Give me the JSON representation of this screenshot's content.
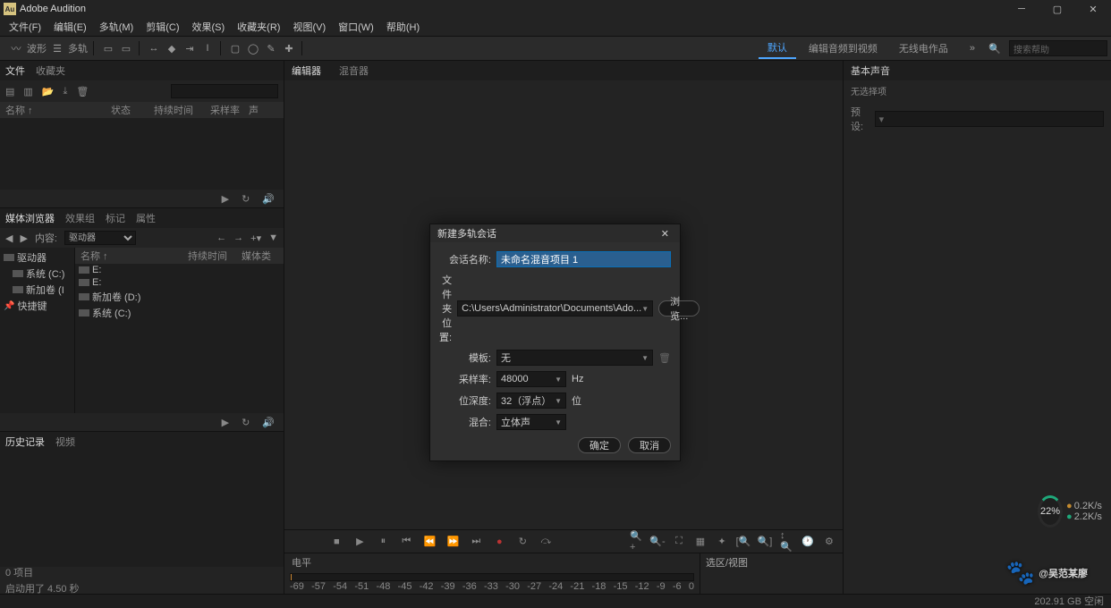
{
  "app": {
    "title": "Adobe Audition"
  },
  "menu": [
    "文件(F)",
    "编辑(E)",
    "多轨(M)",
    "剪辑(C)",
    "效果(S)",
    "收藏夹(R)",
    "视图(V)",
    "窗口(W)",
    "帮助(H)"
  ],
  "toolbar": {
    "waveform": "波形",
    "multitrack": "多轨"
  },
  "workspaces": {
    "default": "默认",
    "edit": "编辑音频到视频",
    "radio": "无线电作品"
  },
  "search_placeholder": "搜索帮助",
  "files_panel": {
    "tab_files": "文件",
    "tab_favorites": "收藏夹",
    "cols": [
      "名称 ↑",
      "状态",
      "持续时间",
      "采样率",
      "声"
    ]
  },
  "media_panel": {
    "tabs": [
      "媒体浏览器",
      "效果组",
      "标记",
      "属性"
    ],
    "content_label": "内容:",
    "content_value": "驱动器",
    "tree": [
      "驱动器",
      "系统 (C:)",
      "新加卷 (I",
      "快捷键"
    ],
    "right_tree": [
      "E:",
      "E:",
      "新加卷 (D:)",
      "系统 (C:)"
    ],
    "cols": [
      "名称 ↑",
      "持续时间",
      "媒体类"
    ]
  },
  "history_panel": {
    "tabs": [
      "历史记录",
      "视频"
    ],
    "line1": "0 项目",
    "line2": "启动用了 4.50 秒"
  },
  "editor": {
    "tabs": [
      "编辑器",
      "混音器"
    ]
  },
  "right_panel": {
    "title": "基本声音",
    "subtitle": "无选择项",
    "preset_label": "预设:"
  },
  "levels": {
    "label": "电平",
    "ticks": [
      "-69",
      "-57",
      "-54",
      "-51",
      "-48",
      "-45",
      "-42",
      "-39",
      "-36",
      "-33",
      "-30",
      "-27",
      "-24",
      "-21",
      "-18",
      "-15",
      "-12",
      "-9",
      "-6",
      "0"
    ],
    "zoom_label": "选区/视图"
  },
  "status": {
    "disk": "202.91 GB 空闲"
  },
  "dialog": {
    "title": "新建多轨会话",
    "name_label": "会话名称:",
    "name_value": "未命名混音项目 1",
    "path_label": "文件夹位置:",
    "path_value": "C:\\Users\\Administrator\\Documents\\Ado...",
    "browse": "浏览...",
    "template_label": "模板:",
    "template_value": "无",
    "rate_label": "采样率:",
    "rate_value": "48000",
    "rate_unit": "Hz",
    "depth_label": "位深度:",
    "depth_value": "32（浮点）",
    "depth_unit": "位",
    "mix_label": "混合:",
    "mix_value": "立体声",
    "ok": "确定",
    "cancel": "取消"
  },
  "gauge": {
    "pct": "22%",
    "up": "0.2K/s",
    "dn": "2.2K/s"
  },
  "watermark": "@吴范某廖"
}
